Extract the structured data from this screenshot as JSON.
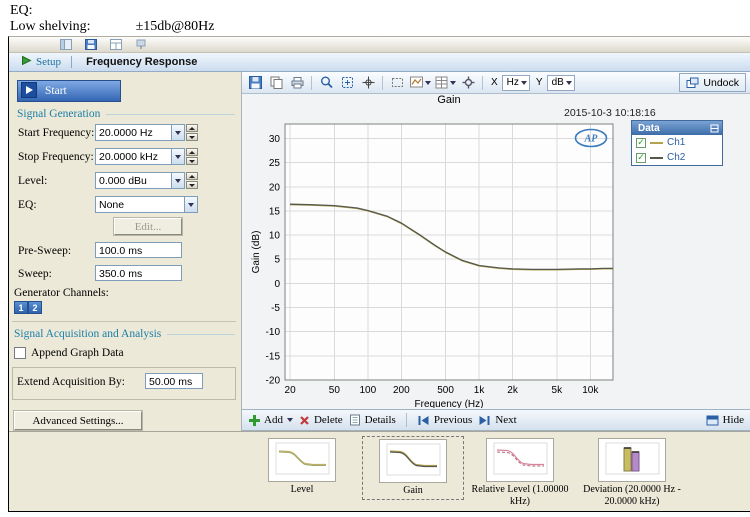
{
  "doc_header": {
    "eq_line": "EQ:",
    "shelf_label": "Low shelving:",
    "shelf_value": "±15db@80Hz"
  },
  "tab_bar": {
    "setup_tab": "Setup",
    "active_tab": "Frequency Response"
  },
  "left_panel": {
    "start_button": "Start",
    "signal_generation_title": "Signal Generation",
    "fields": [
      {
        "label": "Start Frequency:",
        "value": "20.0000 Hz"
      },
      {
        "label": "Stop Frequency:",
        "value": "20.0000 kHz"
      },
      {
        "label": "Level:",
        "value": "0.000 dBu"
      },
      {
        "label": "EQ:",
        "value": "None"
      }
    ],
    "edit_button": "Edit...",
    "pre_sweep_label": "Pre-Sweep:",
    "pre_sweep_value": "100.0 ms",
    "sweep_label": "Sweep:",
    "sweep_value": "350.0 ms",
    "generator_channels_label": "Generator Channels:",
    "channel_buttons": [
      "1",
      "2"
    ],
    "signal_acquisition_title": "Signal Acquisition and Analysis",
    "append_graph_data_label": "Append Graph Data",
    "extend_acquisition_label": "Extend Acquisition By:",
    "extend_acquisition_value": "50.00 ms",
    "advanced_settings_button": "Advanced Settings..."
  },
  "chart_toolbar": {
    "x_label": "X",
    "x_unit": "Hz",
    "y_label": "Y",
    "y_unit": "dB",
    "undock_button": "Undock"
  },
  "graph": {
    "title": "Gain",
    "timestamp": "2015-10-3 10:18:16",
    "logo": "AP"
  },
  "legend": {
    "title": "Data",
    "entries": [
      {
        "label": "Ch1",
        "checked": true
      },
      {
        "label": "Ch2",
        "checked": true
      }
    ]
  },
  "chart_data": {
    "type": "line",
    "title": "Gain",
    "xlabel": "Frequency (Hz)",
    "ylabel": "Gain (dB)",
    "x_scale": "log",
    "xlim": [
      18,
      16000
    ],
    "ylim": [
      -20,
      33
    ],
    "grid": true,
    "legend_position": "right",
    "y_ticks": [
      30,
      25,
      20,
      15,
      10,
      5,
      0,
      -5,
      -10,
      -15,
      -20
    ],
    "x_ticks": [
      {
        "v": 20,
        "label": "20"
      },
      {
        "v": 50,
        "label": "50"
      },
      {
        "v": 100,
        "label": "100"
      },
      {
        "v": 200,
        "label": "200"
      },
      {
        "v": 500,
        "label": "500"
      },
      {
        "v": 1000,
        "label": "1k"
      },
      {
        "v": 2000,
        "label": "2k"
      },
      {
        "v": 5000,
        "label": "5k"
      },
      {
        "v": 10000,
        "label": "10k"
      }
    ],
    "series": [
      {
        "name": "Ch1",
        "color": "#b3a24e",
        "x": [
          20,
          30,
          50,
          80,
          100,
          150,
          200,
          300,
          400,
          500,
          700,
          1000,
          1500,
          2000,
          3000,
          5000,
          8000,
          10000,
          13000,
          16000
        ],
        "y": [
          16.3,
          16.2,
          16.0,
          15.5,
          15.0,
          13.8,
          12.4,
          9.8,
          7.8,
          6.4,
          4.7,
          3.6,
          3.1,
          2.9,
          2.8,
          2.8,
          2.9,
          2.9,
          3.0,
          3.0
        ]
      },
      {
        "name": "Ch2",
        "color": "#55584a",
        "x": [
          20,
          30,
          50,
          80,
          100,
          150,
          200,
          300,
          400,
          500,
          700,
          1000,
          1500,
          2000,
          3000,
          5000,
          8000,
          10000,
          13000,
          16000
        ],
        "y": [
          16.4,
          16.3,
          16.1,
          15.6,
          15.1,
          13.9,
          12.5,
          9.9,
          7.9,
          6.5,
          4.8,
          3.7,
          3.2,
          3.0,
          2.9,
          2.9,
          3.0,
          3.0,
          3.1,
          3.1
        ]
      }
    ]
  },
  "bottom_toolbar": {
    "add": "Add",
    "delete": "Delete",
    "details": "Details",
    "previous": "Previous",
    "next": "Next",
    "hide": "Hide"
  },
  "thumbnails": [
    {
      "label": "Level",
      "selected": false
    },
    {
      "label": "Gain",
      "selected": true
    },
    {
      "label": "Relative Level (1.00000 kHz)",
      "selected": false
    },
    {
      "label": "Deviation (20.0000 Hz - 20.0000 kHz)",
      "selected": false
    }
  ]
}
